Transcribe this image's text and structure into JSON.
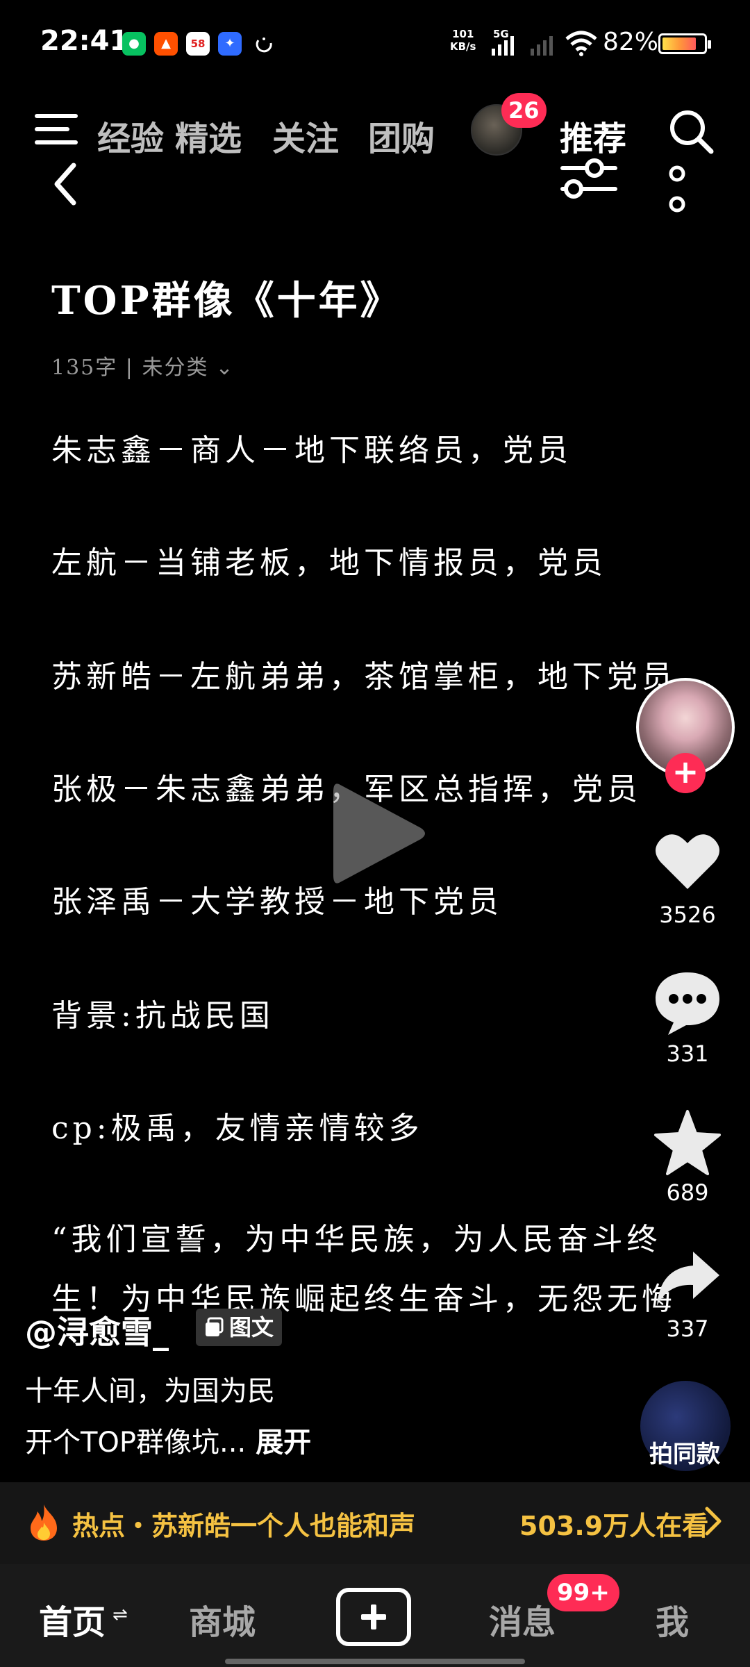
{
  "status_bar": {
    "time": "22:41",
    "net_speed_value": "101",
    "net_speed_unit": "KB/s",
    "network_type": "5G",
    "battery_percent": "82%",
    "battery_level": 0.82,
    "apps": [
      {
        "icon": "wechat-icon",
        "color": "#07c160",
        "glyph": "●"
      },
      {
        "icon": "taobao-icon",
        "color": "#ff5000",
        "glyph": "▲"
      },
      {
        "icon": "58-icon",
        "color": "#ffffff",
        "glyph": "58"
      },
      {
        "icon": "app-icon",
        "color": "#2f6bff",
        "glyph": "✦"
      }
    ]
  },
  "top_nav": {
    "tabs": [
      "经验",
      "精选",
      "关注",
      "团购"
    ],
    "avatar_badge": "26",
    "active_tab": "推荐"
  },
  "article": {
    "title": "TOP群像《十年》",
    "meta": "135字 | 未分类",
    "lines": [
      "朱志鑫－商人－地下联络员，党员",
      "左航－当铺老板，地下情报员，党员",
      "苏新皓－左航弟弟，茶馆掌柜，地下党员",
      "张极－朱志鑫弟弟，军区总指挥，党员",
      "张泽禹－大学教授－地下党员",
      "背景:抗战民国",
      "cp:极禹，友情亲情较多",
      "“我们宣誓，为中华民族，为人民奋斗终",
      "生！为中华民族崛起终生奋斗，无怨无悔"
    ]
  },
  "rail": {
    "likes": "3526",
    "comments": "331",
    "favorites": "689",
    "shares": "337",
    "same_label": "拍同款"
  },
  "post": {
    "author": "@浔愈雪_",
    "type_tag": "图文",
    "caption_line1": "十年人间，为国为民",
    "caption_line2": "开个TOP群像坑...",
    "expand_label": "展开"
  },
  "hot_bar": {
    "text": "热点・苏新皓一个人也能和声",
    "viewers": "503.9万人在看"
  },
  "bottom_nav": {
    "home": "首页",
    "mall": "商城",
    "messages": "消息",
    "messages_badge": "99+",
    "me": "我"
  }
}
